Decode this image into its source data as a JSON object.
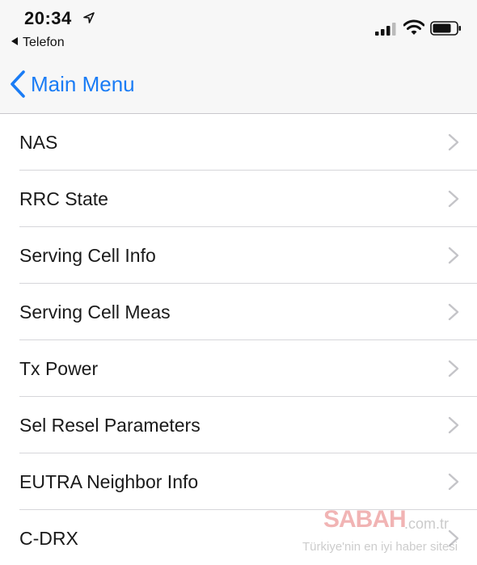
{
  "status_bar": {
    "time": "20:34",
    "back_app": "Telefon",
    "location_icon": "location-arrow-icon",
    "signal_icon": "cellular-signal-icon",
    "wifi_icon": "wifi-icon",
    "battery_icon": "battery-icon"
  },
  "nav": {
    "back_label": "Main Menu",
    "back_icon": "chevron-left-icon",
    "accent_color": "#1a7cf5"
  },
  "menu": {
    "items": [
      {
        "label": "NAS"
      },
      {
        "label": "RRC State"
      },
      {
        "label": "Serving Cell Info"
      },
      {
        "label": "Serving Cell Meas"
      },
      {
        "label": "Tx Power"
      },
      {
        "label": "Sel Resel Parameters"
      },
      {
        "label": "EUTRA Neighbor Info"
      },
      {
        "label": "C-DRX"
      }
    ],
    "chevron_icon": "chevron-right-icon"
  },
  "watermark": {
    "logo": "SABAH",
    "domain": ".com.tr",
    "tagline": "Türkiye'nin en iyi haber sitesi"
  }
}
